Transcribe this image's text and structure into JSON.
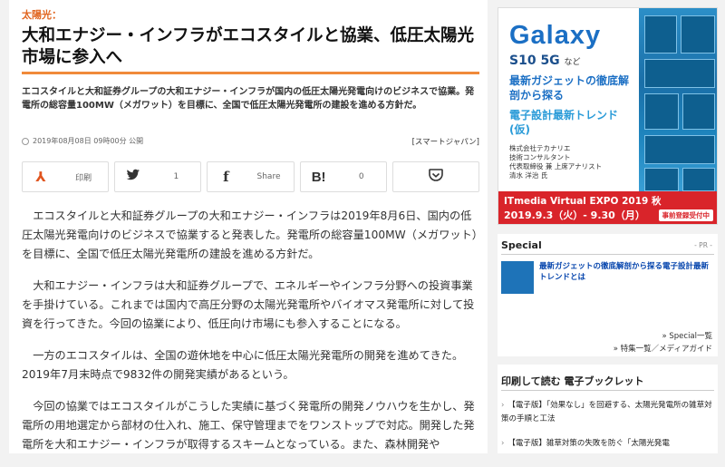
{
  "article": {
    "category": "太陽光：",
    "title": "大和エナジー・インフラがエコスタイルと協業、低圧太陽光市場に参入へ",
    "lead": "エコスタイルと大和証券グループの大和エナジー・インフラが国内の低圧太陽光発電向けのビジネスで協業。発電所の総容量100MW（メガワット）を目標に、全国で低圧太陽光発電所の建設を進める方針だ。",
    "date": "2019年08月08日 09時00分 公開",
    "source": "[スマートジャパン]",
    "share": {
      "print_label": "印刷",
      "twitter_count": "1",
      "facebook_label": "Share",
      "hatena_count": "0"
    },
    "paragraphs": [
      "エコスタイルと大和証券グループの大和エナジー・インフラは2019年8月6日、国内の低圧太陽光発電向けのビジネスで協業すると発表した。発電所の総容量100MW（メガワット）を目標に、全国で低圧太陽光発電所の建設を進める方針だ。",
      "大和エナジー・インフラは大和証券グループで、エネルギーやインフラ分野への投資事業を手掛けている。これまでは国内で高圧分野の太陽光発電所やバイオマス発電所に対して投資を行ってきた。今回の協業により、低圧向け市場にも参入することになる。",
      "一方のエコスタイルは、全国の遊休地を中心に低圧太陽光発電所の開発を進めてきた。2019年7月末時点で9832件の開発実績があるという。",
      "今回の協業ではエコスタイルがこうした実績に基づく発電所の開発ノウハウを生かし、発電所の用地選定から部材の仕入れ、施工、保守管理までをワンストップで対応。開発した発電所を大和エナジー・インフラが取得するスキームとなっている。また、森林開発や"
    ]
  },
  "ad": {
    "brand": "Galaxy",
    "model": "S10 5G",
    "model_suffix": "など",
    "headline": "最新ガジェットの徹底解剖から探る",
    "headline2": "電子設計最新トレンド(仮)",
    "company": "株式会社テカナリエ\n技術コンサルタント\n代表取締役 兼 上席アナリスト\n清水 洋治 氏",
    "expo": "ITmedia Virtual EXPO 2019 秋",
    "dates": "2019.9.3（火）- 9.30（月）",
    "register": "事前登録受付中"
  },
  "special": {
    "heading": "Special",
    "pr": "- PR -",
    "link": "最新ガジェットの徹底解剖から探る電子設計最新トレンドとは",
    "more1": "» Special一覧",
    "more2": "» 特集一覧／メディアガイド"
  },
  "booklet": {
    "heading": "印刷して読む 電子ブックレット",
    "items": [
      "【電子版】「効果なし」を回避する、太陽光発電所の雑草対策の手順と工法",
      "【電子版】雑草対策の失敗を防ぐ「太陽光発電"
    ]
  }
}
